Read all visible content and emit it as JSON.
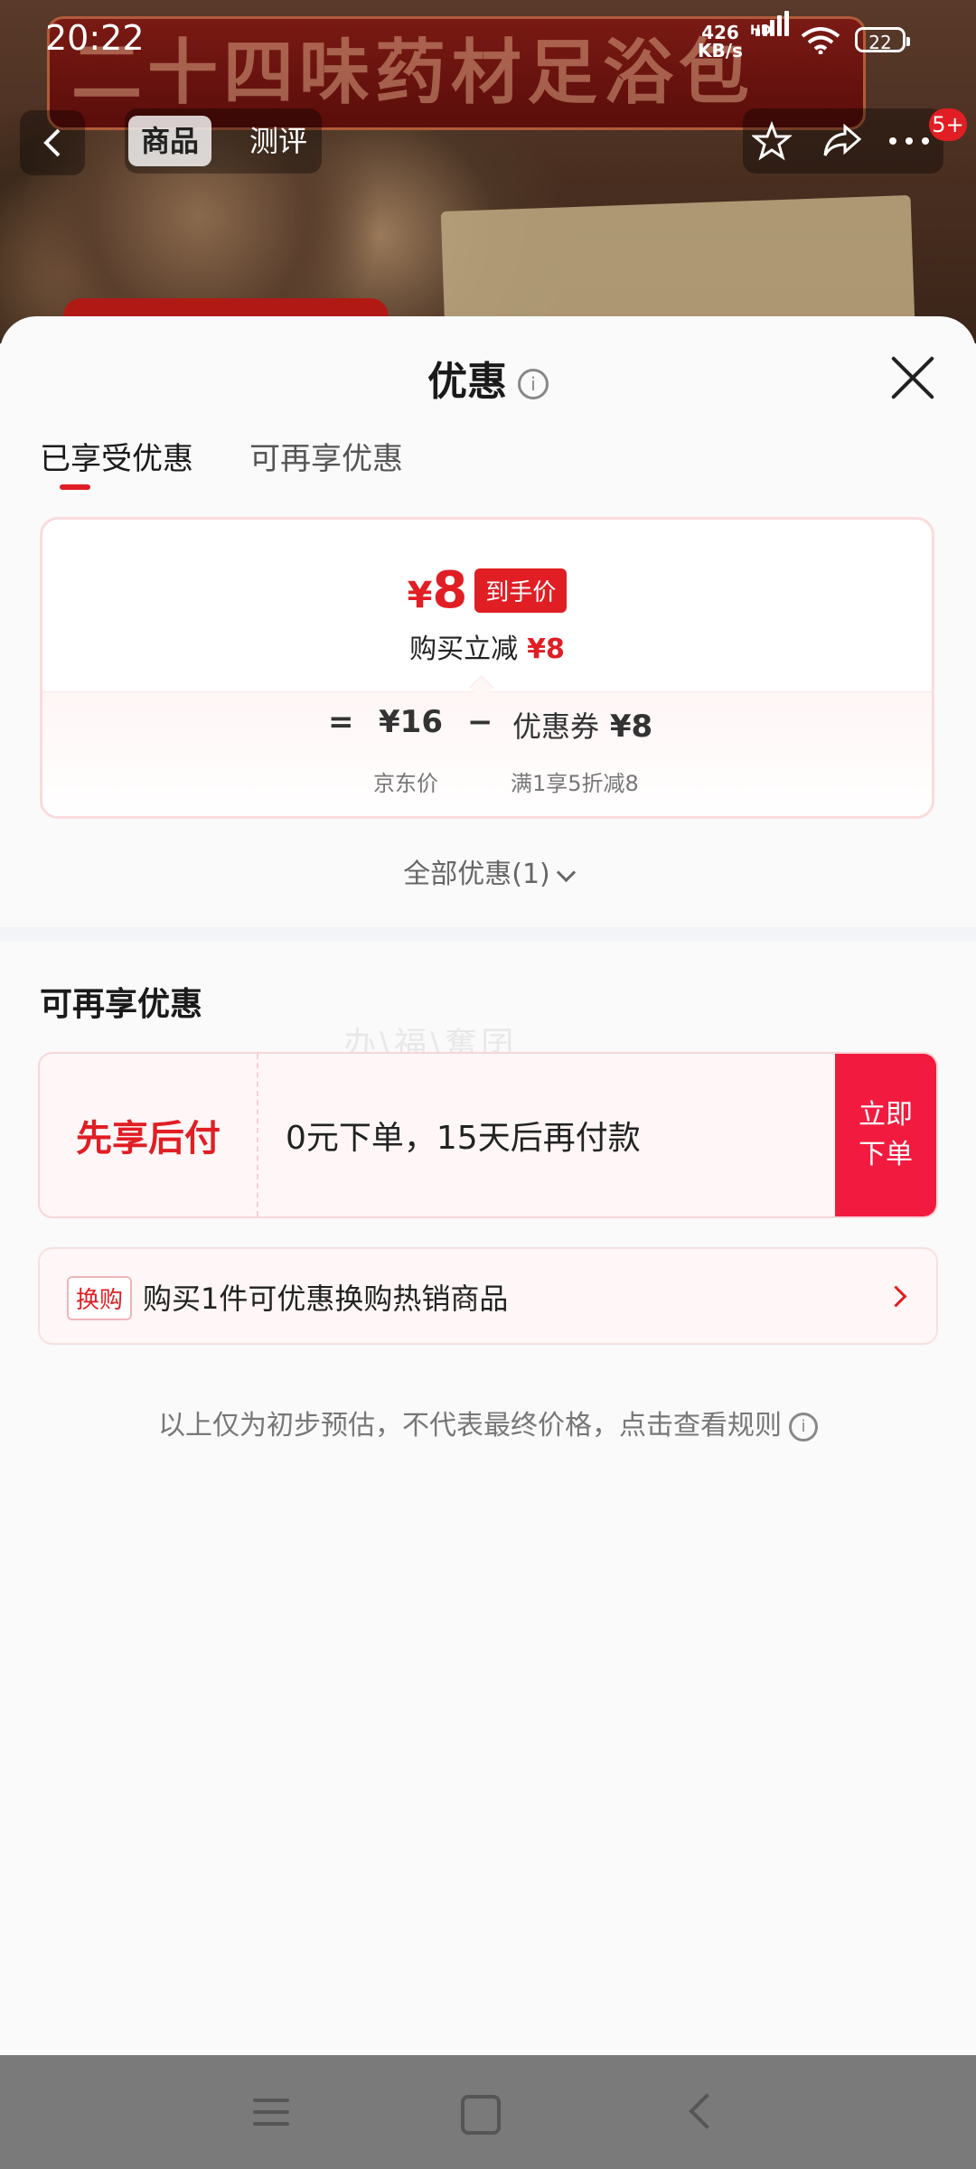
{
  "status_bar": {
    "time": "20:22",
    "speed_value": "426",
    "speed_unit": "KB/s",
    "hd": "HD",
    "battery": "22"
  },
  "banner": {
    "title_text": "二十四味药材足浴包"
  },
  "nav": {
    "tabs": [
      "商品",
      "测评"
    ],
    "cart_badge": "5+"
  },
  "sheet": {
    "title": "优惠",
    "tabs": [
      "已享受优惠",
      "可再享优惠"
    ],
    "summary": {
      "price": "8",
      "currency": "¥",
      "price_tag": "到手价",
      "reduce_label": "购买立减",
      "reduce_amount": "¥8",
      "formula": {
        "eq": "=",
        "base_price": "¥16",
        "minus": "−",
        "coupon_label": "优惠券",
        "coupon_amount": "¥8"
      },
      "base_caption": "京东价",
      "coupon_caption": "满1享5折减8"
    },
    "all_offers": "全部优惠(1)",
    "section_title": "可再享优惠",
    "watermark": "办\\福\\奮囝",
    "pay_later": {
      "label": "先享后付",
      "desc": "0元下单，15天后再付款",
      "button": "立即下单"
    },
    "exchange": {
      "tag": "换购",
      "text": "购买1件可优惠换购热销商品"
    },
    "note": "以上仅为初步预估，不代表最终价格，点击查看规则"
  },
  "colors": {
    "accent": "#e01e24",
    "button_red": "#f21b3f"
  }
}
